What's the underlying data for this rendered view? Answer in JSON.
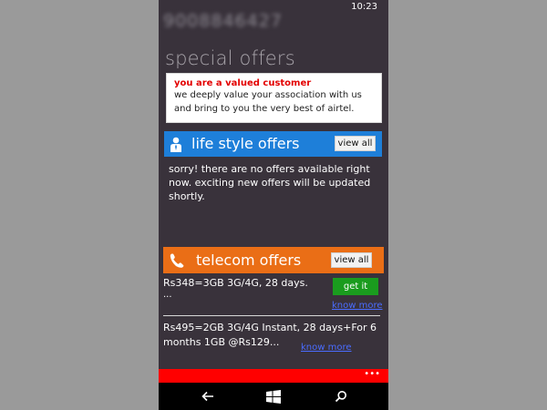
{
  "status_bar": {
    "time": "10:23"
  },
  "header": {
    "phone_number": "9008846427",
    "title": "special offers"
  },
  "notice": {
    "heading": "you are a valued customer",
    "line1": "we deeply value your association with us",
    "line2": "and bring to you the very best of airtel."
  },
  "lifestyle": {
    "icon": "person-icon",
    "title": "life style offers",
    "view_all_label": "view all",
    "empty_message": "sorry! there are no offers available right now. exciting new offers will be updated shortly."
  },
  "telecom": {
    "icon": "phone-icon",
    "title": "telecom offers",
    "view_all_label": "view all",
    "offers": [
      {
        "text": "Rs348=3GB 3G/4G, 28 days.",
        "ellipsis": "...",
        "action": "get it",
        "link": "know more"
      },
      {
        "text": "Rs495=2GB 3G/4G Instant, 28 days+For 6 months 1GB @Rs129...",
        "link": "know more"
      }
    ]
  },
  "app_bar": {
    "more": "•••"
  },
  "nav": {
    "back": "back-icon",
    "home": "windows-icon",
    "search": "search-icon"
  },
  "colors": {
    "background": "#39323b",
    "lifestyle_bar": "#1e7fd9",
    "telecom_bar": "#ea6e16",
    "app_bar": "#ff0000",
    "get_it": "#1a9c1e",
    "notice_heading": "#e30000"
  }
}
